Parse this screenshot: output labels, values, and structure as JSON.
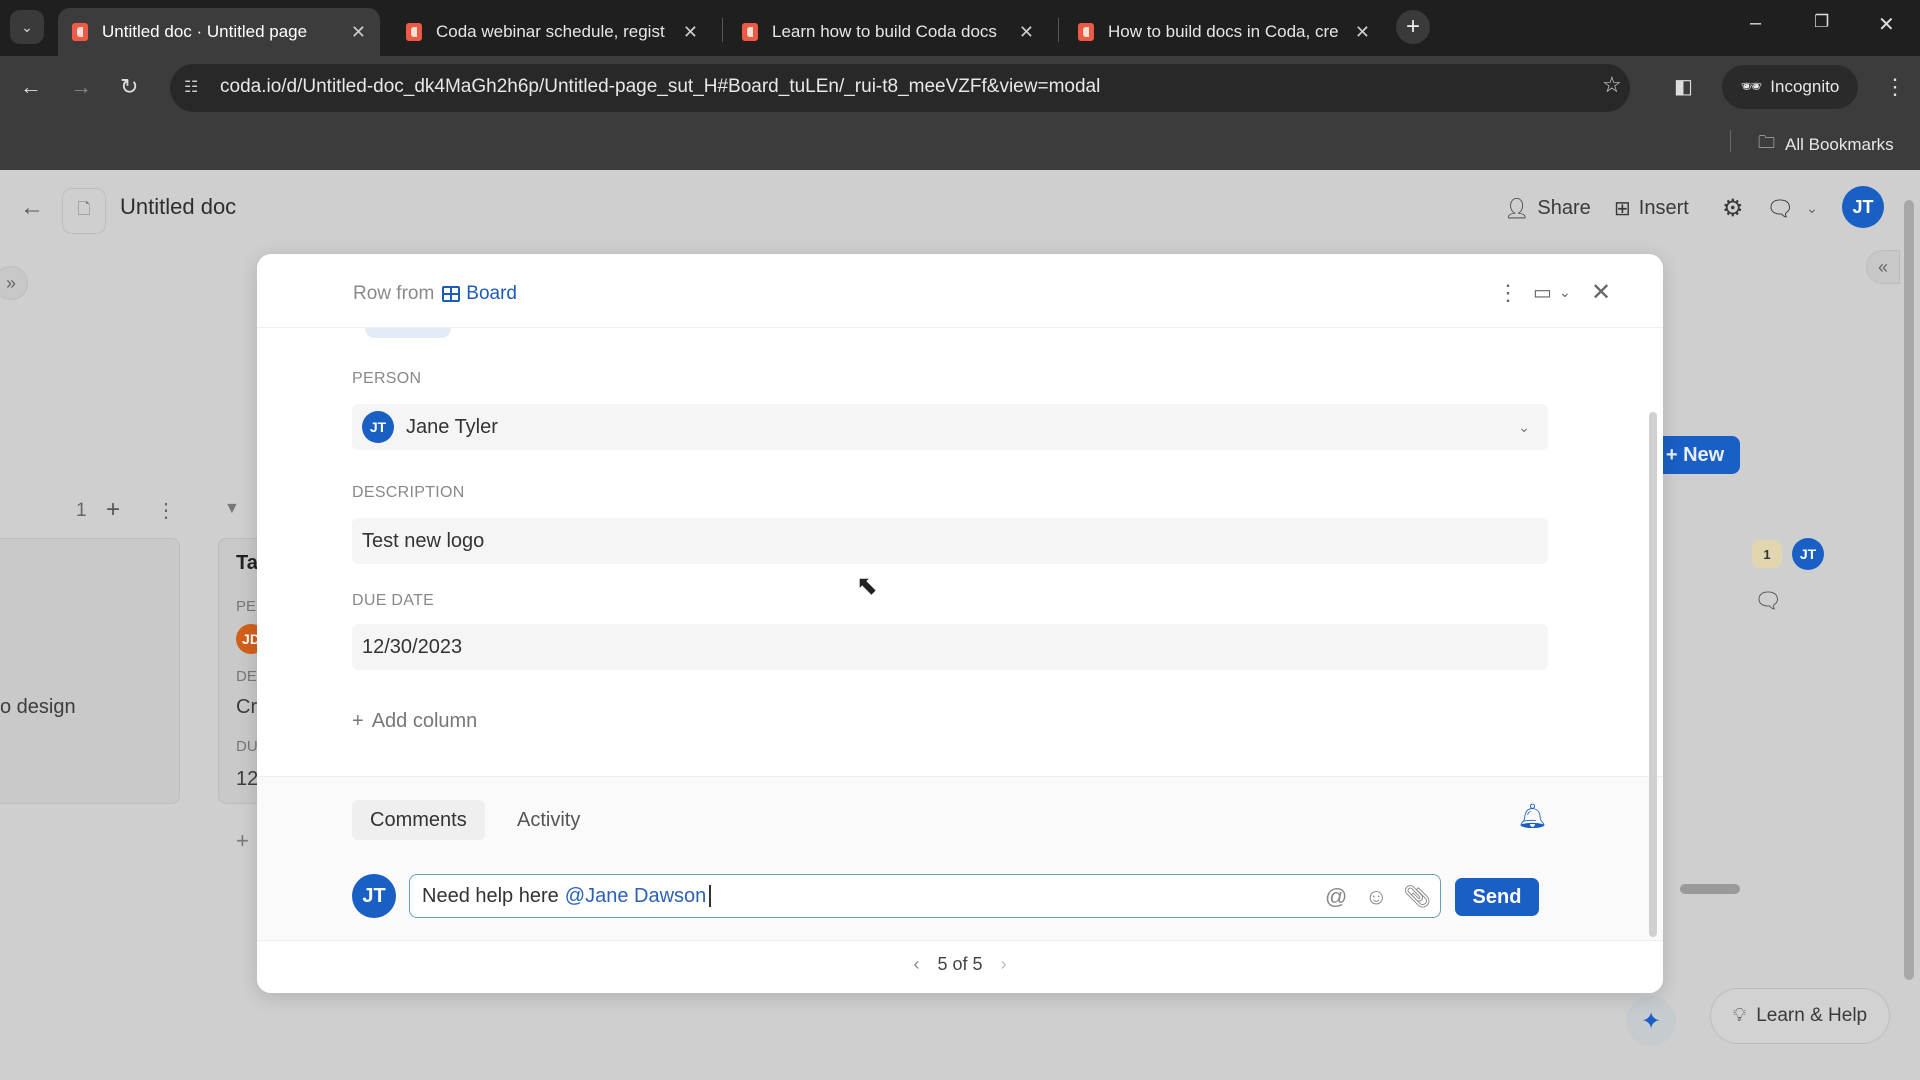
{
  "browser": {
    "tabs": [
      {
        "title": "Untitled doc · Untitled page",
        "active": true
      },
      {
        "title": "Coda webinar schedule, regist",
        "active": false
      },
      {
        "title": "Learn how to build Coda docs",
        "active": false
      },
      {
        "title": "How to build docs in Coda, cre",
        "active": false
      }
    ],
    "url": "coda.io/d/Untitled-doc_dk4MaGh2h6p/Untitled-page_sut_H#Board_tuLEn/_rui-t8_meeVZFf&view=modal",
    "incognito_label": "Incognito",
    "all_bookmarks_label": "All Bookmarks"
  },
  "doc": {
    "title": "Untitled doc",
    "share_label": "Share",
    "insert_label": "Insert",
    "user_initials": "JT"
  },
  "background": {
    "group_count": "1",
    "card_partial_text": "o design",
    "card2_title": "Ta",
    "card2_person_lbl": "PE",
    "card2_avatar": "JD",
    "card2_desc_lbl": "DE",
    "card2_desc": "Cr",
    "card2_due_lbl": "DU",
    "card2_due": "12",
    "new_label": "New",
    "comment_badge_count": "1",
    "learn_help_label": "Learn & Help"
  },
  "modal": {
    "row_from_label": "Row from",
    "source_table": "Board",
    "fields": [
      {
        "label": "PERSON",
        "value": "Jane Tyler",
        "avatar": "JT"
      },
      {
        "label": "DESCRIPTION",
        "value": "Test new logo"
      },
      {
        "label": "DUE DATE",
        "value": "12/30/2023"
      }
    ],
    "add_column_label": "Add column",
    "tabs": {
      "comments": "Comments",
      "activity": "Activity"
    },
    "comment": {
      "avatar": "JT",
      "text": "Need help here",
      "mention": "@Jane Dawson",
      "send_label": "Send"
    },
    "pager": "5 of 5"
  },
  "colors": {
    "accent": "#1a5fc4",
    "coda_red": "#ee5a44"
  }
}
